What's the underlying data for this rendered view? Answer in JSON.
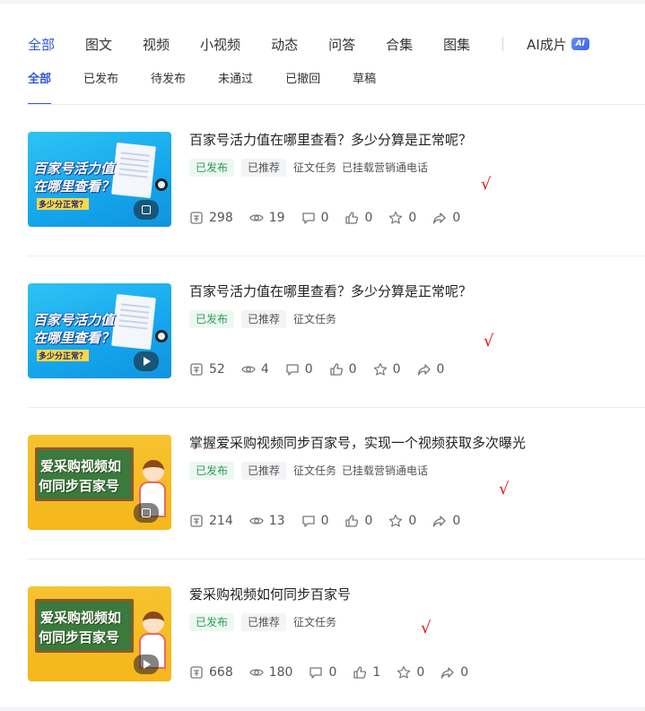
{
  "main_tabs": [
    "全部",
    "图文",
    "视频",
    "小视频",
    "动态",
    "问答",
    "合集",
    "图集"
  ],
  "ai_tab": {
    "label": "AI成片",
    "badge": "AI"
  },
  "sub_tabs": [
    "全部",
    "已发布",
    "待发布",
    "未通过",
    "已撤回",
    "草稿"
  ],
  "items": [
    {
      "title": "百家号活力值在哪里查看？多少分算是正常呢？",
      "tags": [
        "已发布",
        "已推荐",
        "征文任务",
        "已挂载营销通电话"
      ],
      "thumb": {
        "line1": "百家号活力值",
        "line2": "在哪里查看？",
        "line3": "多少分正常？",
        "theme": "blue",
        "media_icon": "gallery-icon"
      },
      "stats": {
        "income": "298",
        "views": "19",
        "comments": "0",
        "likes": "0",
        "favorites": "0",
        "shares": "0"
      },
      "check": "√"
    },
    {
      "title": "百家号活力值在哪里查看？多少分算是正常呢？",
      "tags": [
        "已发布",
        "已推荐",
        "征文任务"
      ],
      "thumb": {
        "line1": "百家号活力值",
        "line2": "在哪里查看？",
        "line3": "多少分正常？",
        "theme": "blue",
        "media_icon": "play-icon"
      },
      "stats": {
        "income": "52",
        "views": "4",
        "comments": "0",
        "likes": "0",
        "favorites": "0",
        "shares": "0"
      },
      "check": "√"
    },
    {
      "title": "掌握爱采购视频同步百家号，实现一个视频获取多次曝光",
      "tags": [
        "已发布",
        "已推荐",
        "征文任务",
        "已挂载营销通电话"
      ],
      "thumb": {
        "line1": "爱采购视频如",
        "line2": "何同步百家号",
        "theme": "yellow",
        "media_icon": "gallery-icon"
      },
      "stats": {
        "income": "214",
        "views": "13",
        "comments": "0",
        "likes": "0",
        "favorites": "0",
        "shares": "0"
      },
      "check": "√"
    },
    {
      "title": "爱采购视频如何同步百家号",
      "tags": [
        "已发布",
        "已推荐",
        "征文任务"
      ],
      "thumb": {
        "line1": "爱采购视频如",
        "line2": "何同步百家号",
        "theme": "yellow",
        "media_icon": "play-icon"
      },
      "stats": {
        "income": "668",
        "views": "180",
        "comments": "0",
        "likes": "1",
        "favorites": "0",
        "shares": "0"
      },
      "check": "√"
    }
  ],
  "colors": {
    "accent": "#2f58d6",
    "published": "#2a9d57",
    "check": "#e41818"
  }
}
